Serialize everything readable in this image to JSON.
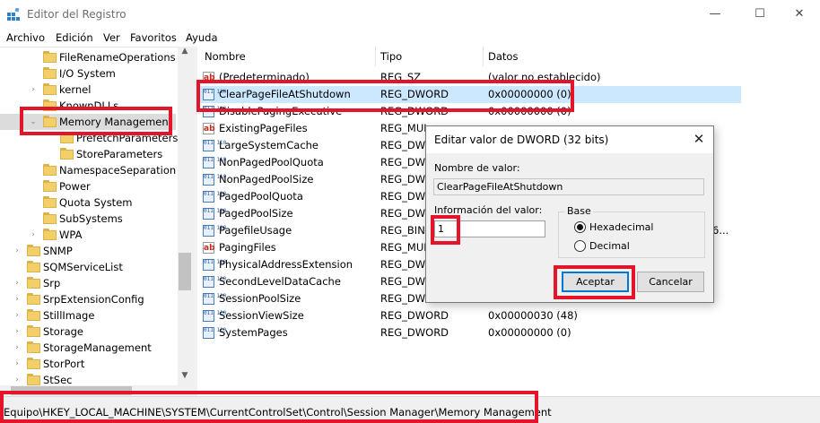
{
  "window": {
    "title": "Editor del Registro",
    "minimize": "—",
    "maximize": "☐",
    "close": "✕"
  },
  "menu": [
    "Archivo",
    "Edición",
    "Ver",
    "Favoritos",
    "Ayuda"
  ],
  "tree": [
    {
      "label": "FileRenameOperations",
      "arrow": ""
    },
    {
      "label": "I/O System",
      "arrow": ""
    },
    {
      "label": "kernel",
      "arrow": "›"
    },
    {
      "label": "KnownDLLs",
      "arrow": ""
    },
    {
      "label": "Memory Management",
      "arrow": "⌄"
    },
    {
      "label": "PrefetchParameters",
      "arrow": ""
    },
    {
      "label": "StoreParameters",
      "arrow": ""
    },
    {
      "label": "NamespaceSeparation",
      "arrow": ""
    },
    {
      "label": "Power",
      "arrow": ""
    },
    {
      "label": "Quota System",
      "arrow": ""
    },
    {
      "label": "SubSystems",
      "arrow": ""
    },
    {
      "label": "WPA",
      "arrow": "›"
    },
    {
      "label": "SNMP",
      "arrow": "›"
    },
    {
      "label": "SQMServiceList",
      "arrow": ""
    },
    {
      "label": "Srp",
      "arrow": "›"
    },
    {
      "label": "SrpExtensionConfig",
      "arrow": "›"
    },
    {
      "label": "StillImage",
      "arrow": "›"
    },
    {
      "label": "Storage",
      "arrow": "›"
    },
    {
      "label": "StorageManagement",
      "arrow": "›"
    },
    {
      "label": "StorPort",
      "arrow": "›"
    },
    {
      "label": "StSec",
      "arrow": "›"
    }
  ],
  "list": {
    "headers": {
      "name": "Nombre",
      "type": "Tipo",
      "data": "Datos"
    },
    "rows": [
      {
        "icon": "ab",
        "name": "(Predeterminado)",
        "type": "REG_SZ",
        "data": "(valor no establecido)"
      },
      {
        "icon": "bin",
        "name": "ClearPageFileAtShutdown",
        "type": "REG_DWORD",
        "data": "0x00000000 (0)",
        "selected": true
      },
      {
        "icon": "bin",
        "name": "DisablePagingExecutive",
        "type": "REG_DWORD",
        "data": "0x00000000 (0)"
      },
      {
        "icon": "ab",
        "name": "ExistingPageFiles",
        "type": "REG_MUL",
        "data": ""
      },
      {
        "icon": "bin",
        "name": "LargeSystemCache",
        "type": "REG_DWO",
        "data": ""
      },
      {
        "icon": "bin",
        "name": "NonPagedPoolQuota",
        "type": "REG_DWO",
        "data": ""
      },
      {
        "icon": "bin",
        "name": "NonPagedPoolSize",
        "type": "REG_DWO",
        "data": ""
      },
      {
        "icon": "bin",
        "name": "PagedPoolQuota",
        "type": "REG_DWO",
        "data": ""
      },
      {
        "icon": "bin",
        "name": "PagedPoolSize",
        "type": "REG_DWO",
        "data": ""
      },
      {
        "icon": "bin",
        "name": "PagefileUsage",
        "type": "REG_BINA",
        "data": "6..."
      },
      {
        "icon": "ab",
        "name": "PagingFiles",
        "type": "REG_MUL",
        "data": ""
      },
      {
        "icon": "bin",
        "name": "PhysicalAddressExtension",
        "type": "REG_DWO",
        "data": ""
      },
      {
        "icon": "bin",
        "name": "SecondLevelDataCache",
        "type": "REG_DWO",
        "data": ""
      },
      {
        "icon": "bin",
        "name": "SessionPoolSize",
        "type": "REG_DWO",
        "data": ""
      },
      {
        "icon": "bin",
        "name": "SessionViewSize",
        "type": "REG_DWORD",
        "data": "0x00000030 (48)"
      },
      {
        "icon": "bin",
        "name": "SystemPages",
        "type": "REG_DWORD",
        "data": "0x00000000 (0)"
      }
    ]
  },
  "dialog": {
    "title": "Editar valor de DWORD (32 bits)",
    "close": "✕",
    "name_label": "Nombre de valor:",
    "name_value": "ClearPageFileAtShutdown",
    "value_label": "Información del valor:",
    "value_input": "1",
    "base_label": "Base",
    "radio_hex": "Hexadecimal",
    "radio_dec": "Decimal",
    "base_selected": "Hexadecimal",
    "ok": "Aceptar",
    "cancel": "Cancelar"
  },
  "status": {
    "path": "Equipo\\HKEY_LOCAL_MACHINE\\SYSTEM\\CurrentControlSet\\Control\\Session Manager\\Memory Management"
  },
  "colors": {
    "highlight": "#e2152b",
    "selection": "#cce8ff",
    "folder": "#f3cf6a",
    "accent": "#0078d7"
  }
}
